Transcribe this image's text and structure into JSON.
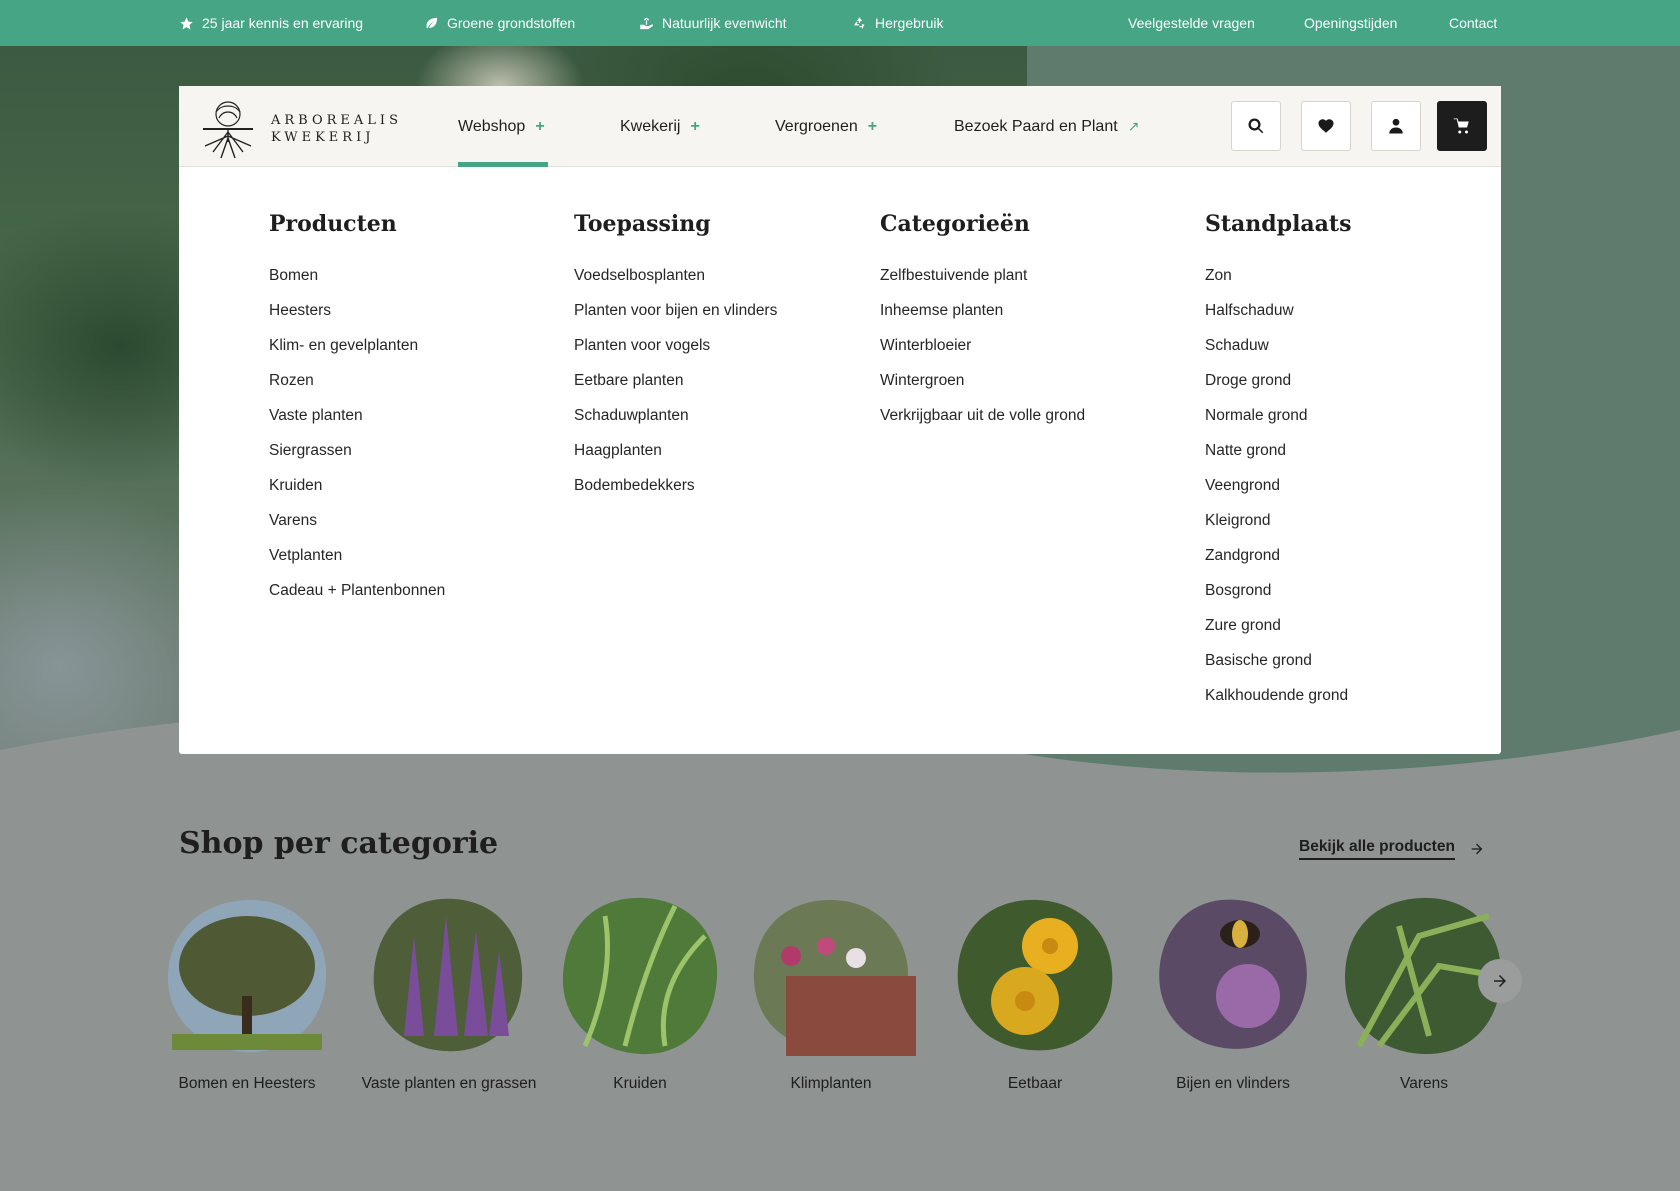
{
  "topbar": {
    "usps": [
      {
        "icon": "star-icon",
        "label": "25 jaar kennis en ervaring"
      },
      {
        "icon": "leaf-icon",
        "label": "Groene grondstoffen"
      },
      {
        "icon": "plant-hand-icon",
        "label": "Natuurlijk evenwicht"
      },
      {
        "icon": "recycle-icon",
        "label": "Hergebruik"
      }
    ],
    "links": [
      "Veelgestelde vragen",
      "Openingstijden",
      "Contact"
    ]
  },
  "header": {
    "logo": {
      "line1": "ARBOREALIS",
      "line2": "KWEKERIJ"
    },
    "nav": [
      {
        "label": "Webshop",
        "suffix": "+"
      },
      {
        "label": "Kwekerij",
        "suffix": "+"
      },
      {
        "label": "Vergroenen",
        "suffix": "+"
      },
      {
        "label": "Bezoek Paard en Plant",
        "suffix": "↗"
      }
    ],
    "icons": [
      "search-icon",
      "heart-icon",
      "user-icon",
      "cart-icon"
    ]
  },
  "mega": {
    "columns": [
      {
        "title": "Producten",
        "items": [
          "Bomen",
          "Heesters",
          "Klim- en gevelplanten",
          "Rozen",
          "Vaste planten",
          "Siergrassen",
          "Kruiden",
          "Varens",
          "Vetplanten",
          "Cadeau + Plantenbonnen"
        ]
      },
      {
        "title": "Toepassing",
        "items": [
          "Voedselbosplanten",
          "Planten voor bijen en vlinders",
          "Planten voor vogels",
          "Eetbare planten",
          "Schaduwplanten",
          "Haagplanten",
          "Bodembedekkers"
        ]
      },
      {
        "title": "Categorieën",
        "items": [
          "Zelfbestuivende plant",
          "Inheemse planten",
          "Winterbloeier",
          "Wintergroen",
          "Verkrijgbaar uit de volle grond"
        ]
      },
      {
        "title": "Standplaats",
        "items": [
          "Zon",
          "Halfschaduw",
          "Schaduw",
          "Droge grond",
          "Normale grond",
          "Natte grond",
          "Veengrond",
          "Kleigrond",
          "Zandgrond",
          "Bosgrond",
          "Zure grond",
          "Basische grond",
          "Kalkhoudende grond"
        ]
      }
    ]
  },
  "shop": {
    "title": "Shop per categorie",
    "see_all": "Bekijk alle producten",
    "categories": [
      {
        "label": "Bomen en Heesters",
        "color": "#4f5a34"
      },
      {
        "label": "Vaste planten en grassen",
        "color": "#7a4d9a"
      },
      {
        "label": "Kruiden",
        "color": "#4f7a3a"
      },
      {
        "label": "Klimplanten",
        "color": "#8a4a3e"
      },
      {
        "label": "Eetbaar",
        "color": "#d8a81e"
      },
      {
        "label": "Bijen en vlinders",
        "color": "#5b4a66"
      },
      {
        "label": "Varens",
        "color": "#4c6a3e"
      }
    ]
  }
}
